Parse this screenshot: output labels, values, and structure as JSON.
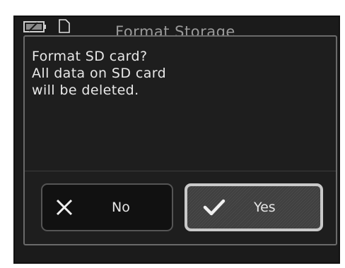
{
  "screen": {
    "title": "Format Storage",
    "battery_icon": "battery-icon",
    "card_icon": "sd-card-icon"
  },
  "dialog": {
    "message_lines": [
      "Format SD card?",
      "All data on SD card",
      "will be deleted."
    ],
    "buttons": {
      "no": {
        "label": "No",
        "icon": "close-icon"
      },
      "yes": {
        "label": "Yes",
        "icon": "checkmark-icon",
        "selected": true
      }
    }
  },
  "colors": {
    "background": "#1b1b1b",
    "text": "#e8e8e8",
    "selected_border": "#c9c9c9"
  }
}
